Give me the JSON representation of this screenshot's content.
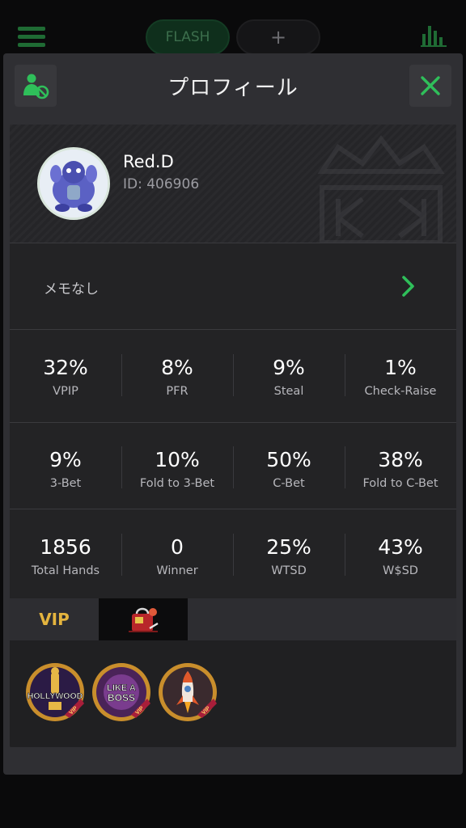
{
  "topbar": {
    "tab_flash": "FLASH",
    "tab_add": "+"
  },
  "modal": {
    "title": "プロフィール",
    "close_icon": "close-icon",
    "block_icon": "user-block-icon"
  },
  "profile": {
    "name": "Red.D",
    "id_text": "ID: 406906",
    "memo": "メモなし"
  },
  "stats": [
    [
      {
        "value": "32%",
        "label": "VPIP"
      },
      {
        "value": "8%",
        "label": "PFR"
      },
      {
        "value": "9%",
        "label": "Steal"
      },
      {
        "value": "1%",
        "label": "Check-Raise"
      }
    ],
    [
      {
        "value": "9%",
        "label": "3-Bet"
      },
      {
        "value": "10%",
        "label": "Fold to 3-Bet"
      },
      {
        "value": "50%",
        "label": "C-Bet"
      },
      {
        "value": "38%",
        "label": "Fold to C-Bet"
      }
    ],
    [
      {
        "value": "1856",
        "label": "Total Hands"
      },
      {
        "value": "0",
        "label": "Winner"
      },
      {
        "value": "25%",
        "label": "WTSD"
      },
      {
        "value": "43%",
        "label": "W$SD"
      }
    ]
  ],
  "tabs": {
    "vip_label": "VIP"
  },
  "badges": [
    {
      "icon": "hollywood-badge-icon",
      "text": "HOLLYWOOD",
      "ribbon": "VIP"
    },
    {
      "icon": "like-a-boss-badge-icon",
      "text_line1": "LIKE A",
      "text_line2": "BOSS",
      "ribbon": "VIP"
    },
    {
      "icon": "rocket-badge-icon",
      "ribbon": "VIP"
    }
  ],
  "colors": {
    "accent_green": "#2fbf5a",
    "gold": "#e4b43e",
    "background": "#0a0a0b"
  }
}
